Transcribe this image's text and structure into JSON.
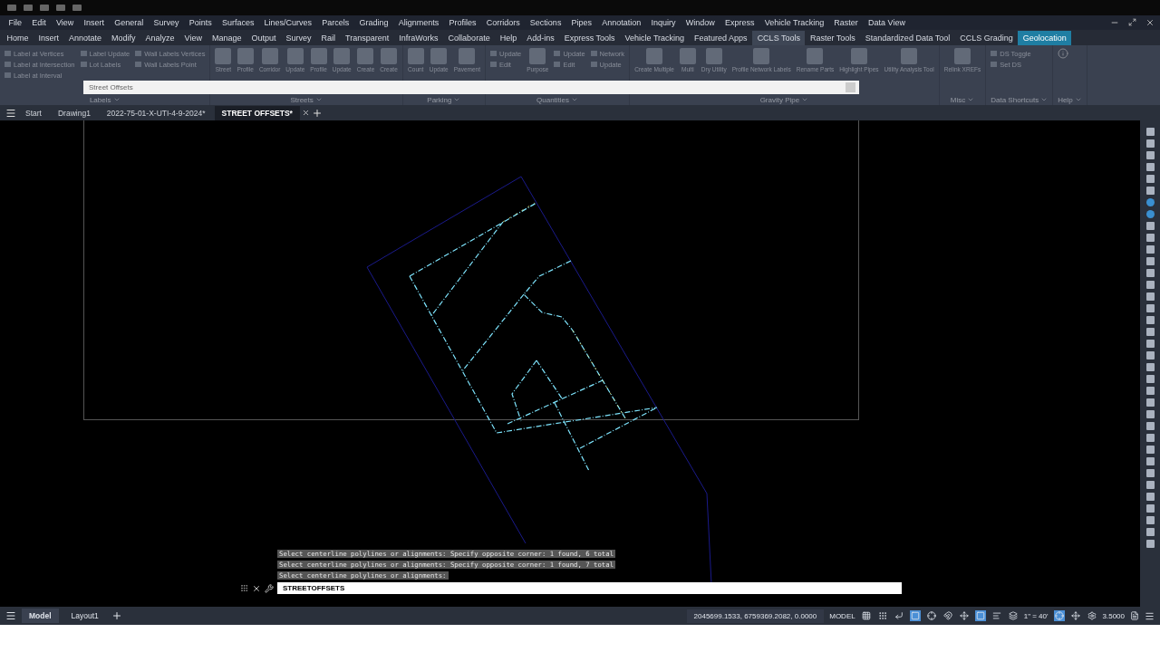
{
  "menu_bar": [
    "File",
    "Edit",
    "View",
    "Insert",
    "General",
    "Survey",
    "Points",
    "Surfaces",
    "Lines/Curves",
    "Parcels",
    "Grading",
    "Alignments",
    "Profiles",
    "Corridors",
    "Sections",
    "Pipes",
    "Annotation",
    "Inquiry",
    "Window",
    "Express",
    "Vehicle Tracking",
    "Raster",
    "Data View"
  ],
  "ribbon_tabs": [
    {
      "label": "Home",
      "selected": false,
      "kind": "normal"
    },
    {
      "label": "Insert",
      "selected": false,
      "kind": "normal"
    },
    {
      "label": "Annotate",
      "selected": false,
      "kind": "normal"
    },
    {
      "label": "Modify",
      "selected": false,
      "kind": "normal"
    },
    {
      "label": "Analyze",
      "selected": false,
      "kind": "normal"
    },
    {
      "label": "View",
      "selected": false,
      "kind": "normal"
    },
    {
      "label": "Manage",
      "selected": false,
      "kind": "normal"
    },
    {
      "label": "Output",
      "selected": false,
      "kind": "normal"
    },
    {
      "label": "Survey",
      "selected": false,
      "kind": "normal"
    },
    {
      "label": "Rail",
      "selected": false,
      "kind": "normal"
    },
    {
      "label": "Transparent",
      "selected": false,
      "kind": "normal"
    },
    {
      "label": "InfraWorks",
      "selected": false,
      "kind": "normal"
    },
    {
      "label": "Collaborate",
      "selected": false,
      "kind": "normal"
    },
    {
      "label": "Help",
      "selected": false,
      "kind": "normal"
    },
    {
      "label": "Add-ins",
      "selected": false,
      "kind": "normal"
    },
    {
      "label": "Express Tools",
      "selected": false,
      "kind": "normal"
    },
    {
      "label": "Vehicle Tracking",
      "selected": false,
      "kind": "normal"
    },
    {
      "label": "Featured Apps",
      "selected": false,
      "kind": "normal"
    },
    {
      "label": "CCLS Tools",
      "selected": true,
      "kind": "normal"
    },
    {
      "label": "Raster Tools",
      "selected": false,
      "kind": "normal"
    },
    {
      "label": "Standardized Data Tool",
      "selected": false,
      "kind": "normal"
    },
    {
      "label": "CCLS Grading",
      "selected": false,
      "kind": "normal"
    },
    {
      "label": "Geolocation",
      "selected": false,
      "kind": "contextual"
    }
  ],
  "ribbon_panels": [
    {
      "title": "Labels",
      "disabled": true,
      "columns": [
        [
          {
            "label": "Label at Vertices",
            "kind": "small"
          },
          {
            "label": "Label at Intersection",
            "kind": "small"
          },
          {
            "label": "Label at Interval",
            "kind": "small"
          }
        ],
        [
          {
            "label": "Label Update",
            "kind": "small"
          },
          {
            "label": "Lot Labels",
            "kind": "small"
          }
        ],
        [
          {
            "label": "Wall Labels Vertices",
            "kind": "small"
          },
          {
            "label": "Wall Labels Point",
            "kind": "small"
          }
        ]
      ]
    },
    {
      "title": "Streets",
      "disabled": true,
      "columns": [
        [
          {
            "label": "Street",
            "kind": "large"
          }
        ],
        [
          {
            "label": "Profile",
            "kind": "large"
          }
        ],
        [
          {
            "label": "Corridor",
            "kind": "large"
          }
        ],
        [
          {
            "label": "Update",
            "kind": "large"
          }
        ],
        [
          {
            "label": "Profile",
            "kind": "large"
          }
        ],
        [
          {
            "label": "Update",
            "kind": "large"
          }
        ],
        [
          {
            "label": "Create",
            "kind": "large"
          }
        ],
        [
          {
            "label": "Create",
            "kind": "large"
          }
        ]
      ]
    },
    {
      "title": "Parking",
      "disabled": true,
      "columns": [
        [
          {
            "label": "Count",
            "kind": "large"
          }
        ],
        [
          {
            "label": "Update",
            "kind": "large"
          }
        ],
        [
          {
            "label": "Pavement",
            "kind": "large"
          }
        ]
      ]
    },
    {
      "title": "Quantities",
      "disabled": true,
      "columns": [
        [
          {
            "label": "Update",
            "kind": "small"
          },
          {
            "label": "Edit",
            "kind": "small"
          }
        ],
        [
          {
            "label": "Purpose",
            "kind": "large"
          }
        ],
        [
          {
            "label": "Update",
            "kind": "small"
          },
          {
            "label": "Edit",
            "kind": "small"
          }
        ],
        [
          {
            "label": "Network",
            "kind": "small"
          },
          {
            "label": "Update",
            "kind": "small"
          }
        ]
      ]
    },
    {
      "title": "Gravity Pipe",
      "disabled": true,
      "columns": [
        [
          {
            "label": "Create Multiple",
            "kind": "large"
          }
        ],
        [
          {
            "label": "Multi",
            "kind": "large"
          }
        ],
        [
          {
            "label": "Dry Utility",
            "kind": "large"
          }
        ],
        [
          {
            "label": "Profile Network Labels",
            "kind": "large"
          }
        ],
        [
          {
            "label": "Rename Parts",
            "kind": "large"
          }
        ],
        [
          {
            "label": "Highlight Pipes",
            "kind": "large"
          }
        ],
        [
          {
            "label": "Utility Analysis Tool",
            "kind": "large"
          }
        ]
      ]
    },
    {
      "title": "Misc",
      "disabled": true,
      "columns": [
        [
          {
            "label": "Relink XREFs",
            "kind": "large"
          }
        ]
      ]
    },
    {
      "title": "Data Shortcuts",
      "disabled": true,
      "columns": [
        [
          {
            "label": "DS Toggle",
            "kind": "small"
          },
          {
            "label": "Set DS",
            "kind": "small"
          }
        ]
      ]
    },
    {
      "title": "Help",
      "disabled": true
    }
  ],
  "palette": {
    "title": "Street Offsets"
  },
  "file_tabs": [
    {
      "label": "Start",
      "selected": false
    },
    {
      "label": "Drawing1",
      "selected": false
    },
    {
      "label": "2022-75-01-X-UTI-4-9-2024*",
      "selected": false
    },
    {
      "label": "STREET OFFSETS*",
      "selected": true
    }
  ],
  "command_history": [
    "Select centerline polylines or alignments: Specify opposite corner: 1 found, 6 total",
    "Select centerline polylines or alignments: Specify opposite corner: 1 found, 7 total",
    "Select centerline polylines or alignments:"
  ],
  "command_input": {
    "value": "STREETOFFSETS"
  },
  "layout_tabs": [
    {
      "label": "Model",
      "selected": true
    },
    {
      "label": "Layout1",
      "selected": false
    }
  ],
  "status_bar": {
    "coordinates": "2045699.1533, 6759369.2082, 0.0000",
    "space": "MODEL",
    "scale": "1\" = 40'",
    "value": "3.5000",
    "toggles": [
      {
        "on": false
      },
      {
        "on": false
      },
      {
        "on": false
      },
      {
        "on": true
      },
      {
        "on": false
      },
      {
        "on": false
      },
      {
        "on": false
      },
      {
        "on": true
      },
      {
        "on": false
      },
      {
        "on": false
      },
      {
        "on": true
      },
      {
        "on": false
      },
      {
        "on": false
      }
    ]
  }
}
